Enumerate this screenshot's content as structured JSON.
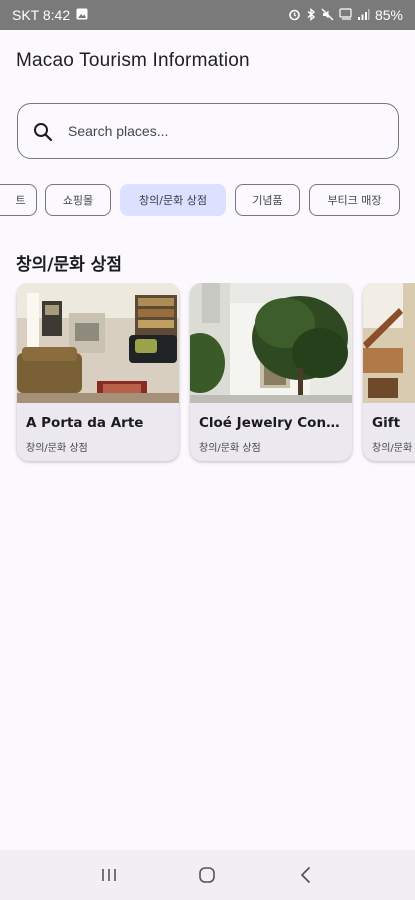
{
  "status": {
    "carrier_time": "SKT 8:42",
    "battery": "85%",
    "left_icons": [
      "gallery-icon"
    ],
    "right_icons": [
      "alarm-icon",
      "bluetooth-icon",
      "mute-icon",
      "volte-icon",
      "signal-icon"
    ]
  },
  "app": {
    "title": "Macao Tourism Information"
  },
  "search": {
    "placeholder": "Search places..."
  },
  "chips": [
    {
      "label": "트",
      "selected": false
    },
    {
      "label": "쇼핑몰",
      "selected": false
    },
    {
      "label": "창의/문화 상점",
      "selected": true
    },
    {
      "label": "기념품",
      "selected": false
    },
    {
      "label": "부티크 매장",
      "selected": false
    }
  ],
  "section": {
    "title": "창의/문화 상점"
  },
  "places": [
    {
      "name": "A Porta da Arte",
      "category": "창의/문화 상점",
      "image": "cozy-shop-interior"
    },
    {
      "name": "Cloé Jewelry Conce...",
      "category": "창의/문화 상점",
      "image": "white-building-with-tree"
    },
    {
      "name": "Gift",
      "category": "창의/문화 상점",
      "image": "shop-staircase"
    }
  ],
  "nav": {
    "icons": [
      "recent-apps-icon",
      "home-icon",
      "back-icon"
    ]
  },
  "colors": {
    "background": "#fbf8fe",
    "chip_selected": "#dbe1ff",
    "card_bg": "#ebe8ef",
    "status_bar": "#7a7a7a"
  }
}
